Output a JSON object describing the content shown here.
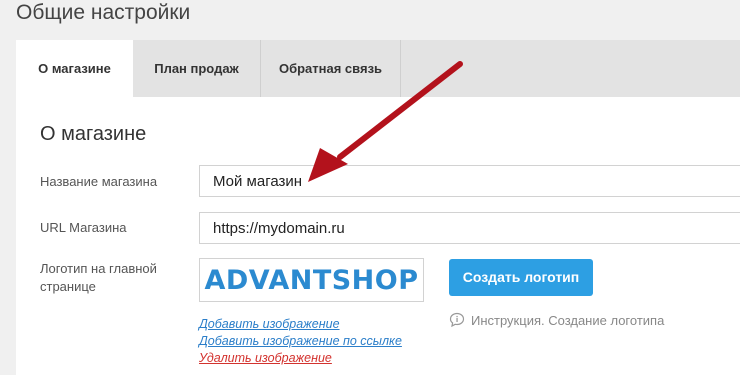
{
  "page": {
    "title": "Общие настройки"
  },
  "tabs": [
    {
      "label": "О магазине",
      "active": true
    },
    {
      "label": "План продаж",
      "active": false
    },
    {
      "label": "Обратная связь",
      "active": false
    }
  ],
  "section": {
    "title": "О магазине"
  },
  "form": {
    "store_name": {
      "label": "Название магазина",
      "value": "Мой магазин"
    },
    "store_url": {
      "label": "URL Магазина",
      "value": "https://mydomain.ru"
    },
    "logo": {
      "label_line1": "Логотип на главной",
      "label_line2": "странице",
      "logo_text": "ADVANTSHOP",
      "create_button": "Создать логотип",
      "links": {
        "add_image": "Добавить изображение",
        "add_image_by_link": "Добавить изображение по ссылке",
        "delete_image": "Удалить изображение"
      },
      "help_text": "Инструкция. Создание логотипа"
    }
  },
  "colors": {
    "accent": "#2d9fe3",
    "link": "#2b7ec9",
    "danger_link": "#d3322e",
    "annotation_arrow": "#b3121c"
  }
}
